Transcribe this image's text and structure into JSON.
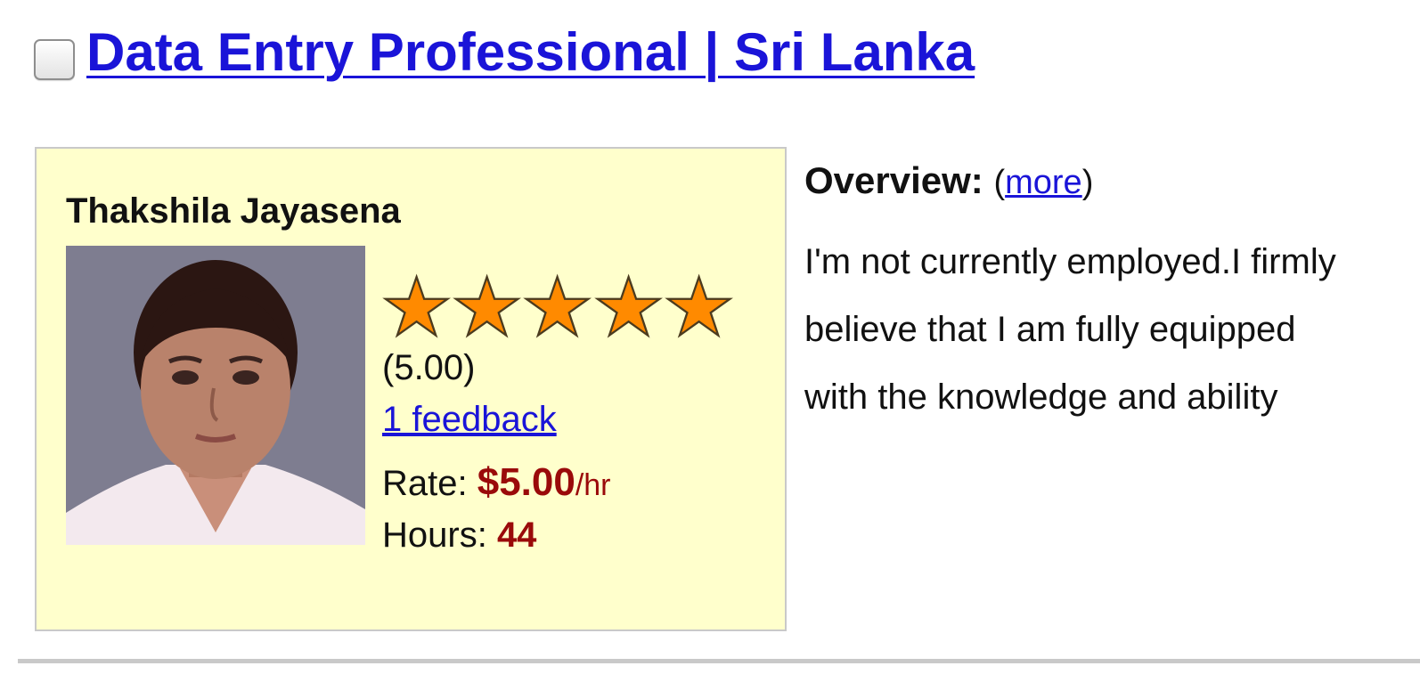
{
  "listing": {
    "title": "Data Entry Professional | Sri Lanka",
    "checked": false
  },
  "profile": {
    "name": "Thakshila Jayasena",
    "avatar_icon": "profile-photo",
    "rating": {
      "stars_total": 5,
      "stars_filled": 5,
      "score_text": "(5.00)",
      "star_color": "#ff8a00"
    },
    "feedback_link": "1 feedback",
    "rate": {
      "label": "Rate: ",
      "value": "$5.00",
      "unit": "/hr"
    },
    "hours": {
      "label": "Hours: ",
      "value": "44"
    },
    "card_background": "#ffffcc"
  },
  "overview": {
    "label": "Overview:",
    "paren_open": "(",
    "more_link": "more",
    "paren_close": ")",
    "text": "I'm not currently employed.I firmly believe that I am fully equipped with the knowledge and ability"
  },
  "colors": {
    "link": "#1a14d8",
    "accent_value": "#9a0a0a"
  }
}
